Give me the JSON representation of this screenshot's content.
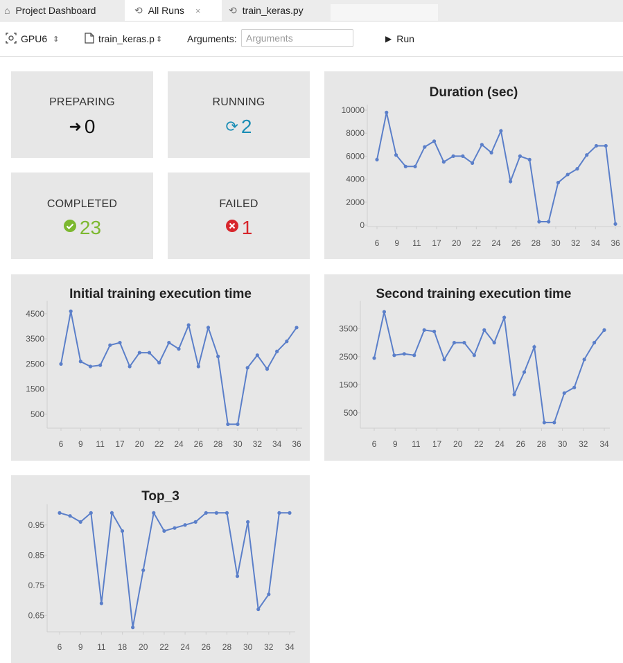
{
  "tabs": [
    {
      "icon": "home-icon",
      "glyph": "⌂",
      "label": "Project Dashboard"
    },
    {
      "icon": "history-icon",
      "glyph": "⟲",
      "label": "All Runs",
      "close": "×"
    },
    {
      "icon": "history-icon",
      "glyph": "⟲",
      "label": "train_keras.py"
    }
  ],
  "toolbar": {
    "gpu_label": "GPU6",
    "script_label": "train_keras.p",
    "arguments_label": "Arguments:",
    "arguments_placeholder": "Arguments",
    "run_label": "Run"
  },
  "stats": {
    "preparing": {
      "label": "PREPARING",
      "value": "0",
      "icon": "sign-in-icon",
      "color": "#111111"
    },
    "running": {
      "label": "RUNNING",
      "value": "2",
      "icon": "refresh-icon",
      "color": "#1a8db5"
    },
    "completed": {
      "label": "COMPLETED",
      "value": "23",
      "icon": "check-circle-icon",
      "color": "#7cb82f"
    },
    "failed": {
      "label": "FAILED",
      "value": "1",
      "icon": "times-circle-icon",
      "color": "#d7262c"
    }
  },
  "colors": {
    "line": "#5b7fc9",
    "panel": "#e7e7e7"
  },
  "chart_data": [
    {
      "id": "duration",
      "type": "line",
      "title": "Duration (sec)",
      "xlabel": "",
      "ylabel": "",
      "ylim": [
        0,
        10000
      ],
      "yticks": [
        "10000",
        "8000",
        "6000",
        "4000",
        "2000",
        "0"
      ],
      "xticks": [
        "6",
        "9",
        "11",
        "17",
        "20",
        "22",
        "24",
        "26",
        "28",
        "30",
        "32",
        "34",
        "36"
      ],
      "values": [
        5700,
        9800,
        6100,
        5100,
        5100,
        6800,
        7300,
        5500,
        6000,
        6000,
        5400,
        7000,
        6300,
        8200,
        3800,
        6000,
        5700,
        300,
        300,
        3700,
        4400,
        4900,
        6100,
        6900,
        6900,
        100
      ]
    },
    {
      "id": "initial",
      "type": "line",
      "title": "Initial training execution time",
      "xlabel": "",
      "ylabel": "",
      "ylim": [
        0,
        4800
      ],
      "yticks": [
        "4500",
        "3500",
        "2500",
        "1500",
        "500"
      ],
      "xticks": [
        "6",
        "9",
        "11",
        "17",
        "20",
        "22",
        "24",
        "26",
        "28",
        "30",
        "32",
        "34",
        "36"
      ],
      "values": [
        2500,
        4600,
        2600,
        2400,
        2450,
        3250,
        3350,
        2400,
        2950,
        2950,
        2550,
        3350,
        3100,
        4050,
        2400,
        3950,
        2800,
        100,
        100,
        2350,
        2850,
        2300,
        3000,
        3400,
        3950
      ]
    },
    {
      "id": "second",
      "type": "line",
      "title": "Second training execution time",
      "xlabel": "",
      "ylabel": "",
      "ylim": [
        0,
        4300
      ],
      "yticks": [
        "3500",
        "2500",
        "1500",
        "500"
      ],
      "xticks": [
        "6",
        "9",
        "11",
        "17",
        "20",
        "22",
        "24",
        "26",
        "28",
        "30",
        "32",
        "34"
      ],
      "values": [
        2450,
        4100,
        2550,
        2600,
        2550,
        3450,
        3400,
        2400,
        3000,
        3000,
        2550,
        3450,
        3000,
        3900,
        1150,
        1950,
        2850,
        150,
        150,
        1200,
        1400,
        2400,
        3000,
        3450
      ]
    },
    {
      "id": "top3",
      "type": "line",
      "title": "Top_3",
      "xlabel": "",
      "ylabel": "",
      "ylim": [
        0.6,
        1.0
      ],
      "yticks": [
        "0.95",
        "0.85",
        "0.75",
        "0.65"
      ],
      "xticks": [
        "6",
        "9",
        "11",
        "18",
        "20",
        "22",
        "24",
        "26",
        "28",
        "30",
        "32",
        "34"
      ],
      "values": [
        0.99,
        0.98,
        0.96,
        0.99,
        0.69,
        0.99,
        0.93,
        0.61,
        0.8,
        0.99,
        0.93,
        0.94,
        0.95,
        0.96,
        0.99,
        0.99,
        0.99,
        0.78,
        0.96,
        0.67,
        0.72,
        0.99,
        0.99
      ]
    }
  ]
}
